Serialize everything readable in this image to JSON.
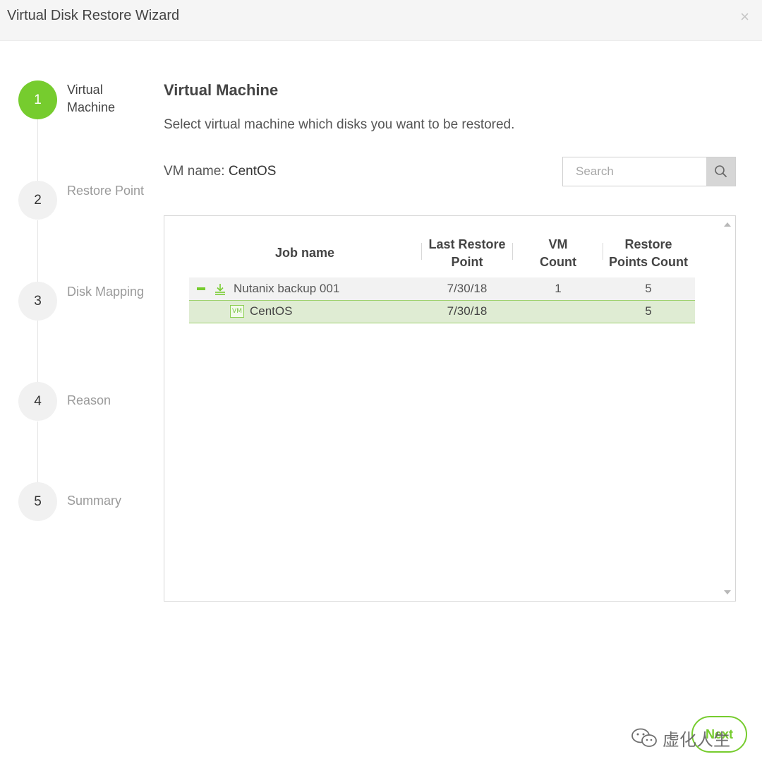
{
  "window": {
    "title": "Virtual Disk Restore Wizard",
    "close_glyph": "×"
  },
  "steps": [
    {
      "number": "1",
      "label": "Virtual Machine",
      "active": true
    },
    {
      "number": "2",
      "label": "Restore Point",
      "active": false
    },
    {
      "number": "3",
      "label": "Disk Mapping",
      "active": false
    },
    {
      "number": "4",
      "label": "Reason",
      "active": false
    },
    {
      "number": "5",
      "label": "Summary",
      "active": false
    }
  ],
  "main": {
    "heading": "Virtual Machine",
    "description": "Select virtual machine which disks you want to be restored.",
    "vm_name_label": "VM name:",
    "vm_name_value": "CentOS"
  },
  "search": {
    "placeholder": "Search",
    "value": ""
  },
  "table": {
    "columns": [
      "Job name",
      "Last Restore Point",
      "VM Count",
      "Restore Points Count"
    ],
    "rows": [
      {
        "type": "job",
        "name": "Nutanix backup 001",
        "last_restore_point": "7/30/18",
        "vm_count": "1",
        "restore_points_count": "5"
      },
      {
        "type": "vm",
        "icon_text": "VM",
        "name": "CentOS",
        "last_restore_point": "7/30/18",
        "vm_count": "",
        "restore_points_count": "5"
      }
    ]
  },
  "footer": {
    "next_label": "Next"
  },
  "watermark": {
    "text": "虚化人生"
  },
  "colors": {
    "accent": "#76cc2e",
    "selected_row": "#dfecd3",
    "group_row": "#f2f2f2"
  },
  "icons": [
    "close-icon",
    "search-icon",
    "collapse-icon",
    "job-download-icon",
    "vm-icon",
    "scroll-up-icon",
    "scroll-down-icon"
  ]
}
